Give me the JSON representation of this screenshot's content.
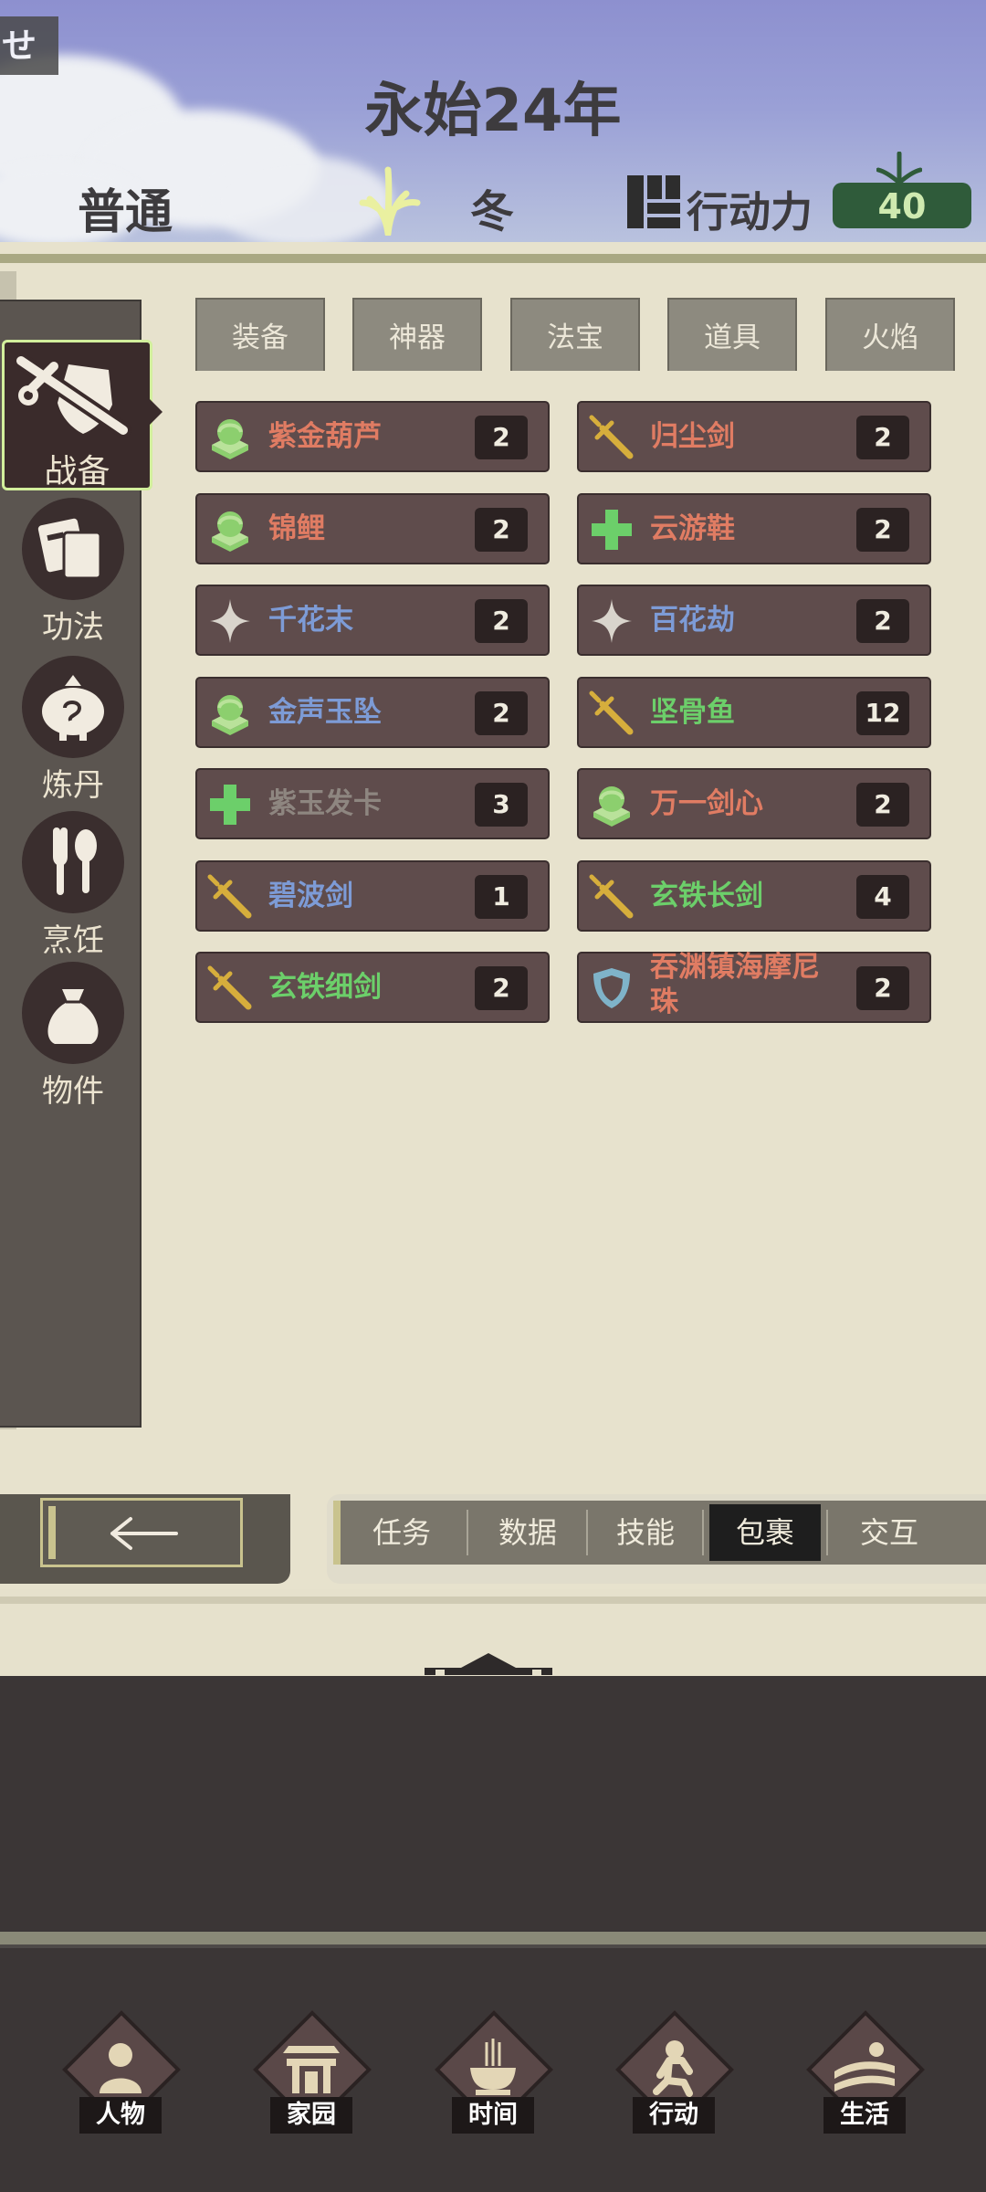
{
  "header": {
    "corner_tag": "せ",
    "year": "永始24年",
    "difficulty": "普通",
    "season": "冬",
    "action_points_label": "行动力",
    "action_points": "40"
  },
  "sidebar": {
    "items": [
      {
        "label": "战备",
        "icon": "armor-sword-icon",
        "active": true
      },
      {
        "label": "功法",
        "icon": "scroll-icon"
      },
      {
        "label": "炼丹",
        "icon": "alchemy-pot-icon"
      },
      {
        "label": "烹饪",
        "icon": "utensils-icon"
      },
      {
        "label": "物件",
        "icon": "bag-icon"
      }
    ]
  },
  "tabs": [
    "装备",
    "神器",
    "法宝",
    "道具",
    "火焰"
  ],
  "items": [
    {
      "name": "紫金葫芦",
      "count": "2",
      "icon": "jade-ring-icon",
      "color": "#e07c63"
    },
    {
      "name": "归尘剑",
      "count": "2",
      "icon": "sword-icon",
      "color": "#e07c63"
    },
    {
      "name": "锦鲤",
      "count": "2",
      "icon": "jade-ring-icon",
      "color": "#e07c63"
    },
    {
      "name": "云游鞋",
      "count": "2",
      "icon": "cross-icon",
      "color": "#e07c63"
    },
    {
      "name": "千花末",
      "count": "2",
      "icon": "sparkle-icon",
      "color": "#7d9bd6"
    },
    {
      "name": "百花劫",
      "count": "2",
      "icon": "sparkle-icon",
      "color": "#7d9bd6"
    },
    {
      "name": "金声玉坠",
      "count": "2",
      "icon": "jade-ring-icon",
      "color": "#7d9bd6"
    },
    {
      "name": "坚骨鱼",
      "count": "12",
      "icon": "sword-icon",
      "color": "#6ccf6a"
    },
    {
      "name": "紫玉发卡",
      "count": "3",
      "icon": "cross-icon",
      "color": "#8e8680"
    },
    {
      "name": "万一剑心",
      "count": "2",
      "icon": "jade-ring-icon",
      "color": "#e07c63"
    },
    {
      "name": "碧波剑",
      "count": "1",
      "icon": "sword-icon",
      "color": "#7d9bd6"
    },
    {
      "name": "玄铁长剑",
      "count": "4",
      "icon": "sword-icon",
      "color": "#6ccf6a"
    },
    {
      "name": "玄铁细剑",
      "count": "2",
      "icon": "sword-icon",
      "color": "#6ccf6a"
    },
    {
      "name": "吞渊镇海摩尼珠",
      "count": "2",
      "icon": "shield-icon",
      "color": "#e07c63"
    }
  ],
  "bottom_tabs": [
    "任务",
    "数据",
    "技能",
    "包裹",
    "交互"
  ],
  "active_bottom_tab": "包裹",
  "nav": [
    "人物",
    "家园",
    "时间",
    "行动",
    "生活"
  ]
}
